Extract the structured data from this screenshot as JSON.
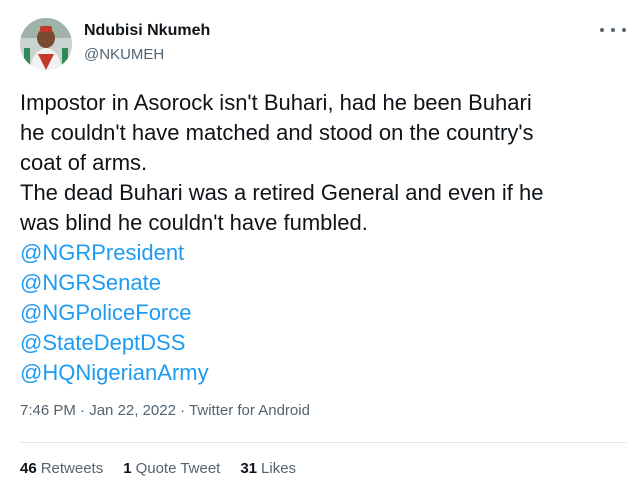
{
  "user": {
    "display_name": "Ndubisi Nkumeh",
    "handle": "@NKUMEH"
  },
  "tweet": {
    "lines": [
      "Impostor in Asorock isn't Buhari, had he been Buhari",
      "he couldn't have matched and stood on the country's",
      "coat of arms.",
      "The dead Buhari was a retired General and even if he",
      "was blind he couldn't have  fumbled."
    ],
    "mentions": [
      "@NGRPresident",
      "@NGRSenate",
      "@NGPoliceForce",
      "@StateDeptDSS",
      "@HQNigerianArmy"
    ]
  },
  "meta": {
    "time": "7:46 PM",
    "date": "Jan 22, 2022",
    "source": "Twitter for Android",
    "separator": " · "
  },
  "stats": {
    "retweets_count": "46",
    "retweets_label": "Retweets",
    "quotes_count": "1",
    "quotes_label": "Quote Tweet",
    "likes_count": "31",
    "likes_label": "Likes"
  },
  "colors": {
    "link": "#1d9bf0",
    "text": "#0f1419",
    "secondary": "#536471"
  }
}
